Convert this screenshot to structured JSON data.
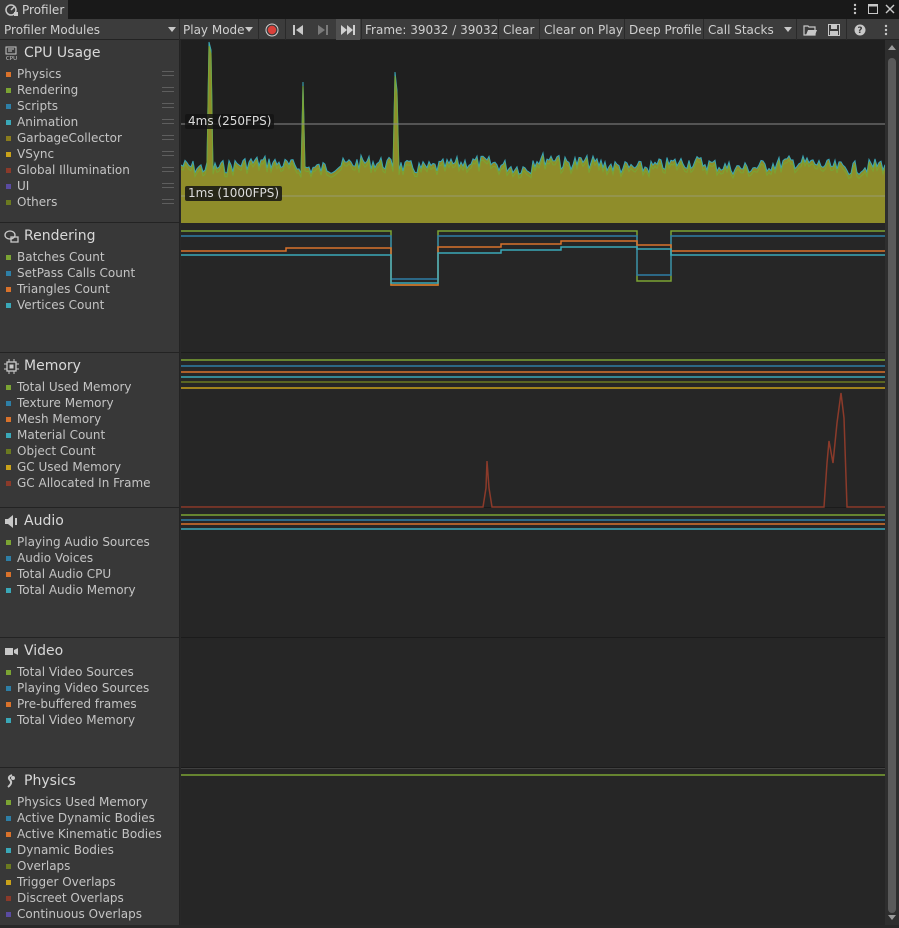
{
  "window": {
    "tab_label": "Profiler",
    "menu_icon": "kebab-menu-icon",
    "maximize_icon": "maximize-icon",
    "close_icon": "close-icon"
  },
  "toolbar": {
    "modules_dropdown": "Profiler Modules",
    "target_dropdown": "Play Mode",
    "frame_label": "Frame: 39032 / 39032",
    "clear": "Clear",
    "clear_on_play": "Clear on Play",
    "deep_profile": "Deep Profile",
    "call_stacks": "Call Stacks"
  },
  "colors": {
    "green": "#7ba433",
    "blue": "#2e7fa6",
    "orange": "#d9722b",
    "cyan": "#3aa8b8",
    "olive": "#8a7c1d",
    "yellow": "#c9a21a",
    "darkred": "#8b3a2a",
    "purple": "#5a4ba0",
    "olivegreen": "#6b7a20"
  },
  "modules": [
    {
      "id": "cpu",
      "title": "CPU Usage",
      "icon": "cpu-icon",
      "series": [
        {
          "label": "Physics",
          "color": "#d9722b"
        },
        {
          "label": "Rendering",
          "color": "#7ba433"
        },
        {
          "label": "Scripts",
          "color": "#2e7fa6"
        },
        {
          "label": "Animation",
          "color": "#3aa8b8"
        },
        {
          "label": "GarbageCollector",
          "color": "#8a7c1d"
        },
        {
          "label": "VSync",
          "color": "#c9a21a"
        },
        {
          "label": "Global Illumination",
          "color": "#8b3a2a"
        },
        {
          "label": "UI",
          "color": "#5a4ba0"
        },
        {
          "label": "Others",
          "color": "#6b7a20"
        }
      ],
      "chart_labels": [
        "4ms (250FPS)",
        "1ms (1000FPS)"
      ]
    },
    {
      "id": "rendering",
      "title": "Rendering",
      "icon": "rendering-icon",
      "series": [
        {
          "label": "Batches Count",
          "color": "#7ba433"
        },
        {
          "label": "SetPass Calls Count",
          "color": "#2e7fa6"
        },
        {
          "label": "Triangles Count",
          "color": "#d9722b"
        },
        {
          "label": "Vertices Count",
          "color": "#3aa8b8"
        }
      ]
    },
    {
      "id": "memory",
      "title": "Memory",
      "icon": "memory-chip-icon",
      "series": [
        {
          "label": "Total Used Memory",
          "color": "#7ba433"
        },
        {
          "label": "Texture Memory",
          "color": "#2e7fa6"
        },
        {
          "label": "Mesh Memory",
          "color": "#d9722b"
        },
        {
          "label": "Material Count",
          "color": "#3aa8b8"
        },
        {
          "label": "Object Count",
          "color": "#6b7a20"
        },
        {
          "label": "GC Used Memory",
          "color": "#c9a21a"
        },
        {
          "label": "GC Allocated In Frame",
          "color": "#8b3a2a"
        }
      ]
    },
    {
      "id": "audio",
      "title": "Audio",
      "icon": "speaker-icon",
      "series": [
        {
          "label": "Playing Audio Sources",
          "color": "#7ba433"
        },
        {
          "label": "Audio Voices",
          "color": "#2e7fa6"
        },
        {
          "label": "Total Audio CPU",
          "color": "#d9722b"
        },
        {
          "label": "Total Audio Memory",
          "color": "#3aa8b8"
        }
      ]
    },
    {
      "id": "video",
      "title": "Video",
      "icon": "video-camera-icon",
      "series": [
        {
          "label": "Total Video Sources",
          "color": "#7ba433"
        },
        {
          "label": "Playing Video Sources",
          "color": "#2e7fa6"
        },
        {
          "label": "Pre-buffered frames",
          "color": "#d9722b"
        },
        {
          "label": "Total Video Memory",
          "color": "#3aa8b8"
        }
      ]
    },
    {
      "id": "physics",
      "title": "Physics",
      "icon": "physics-icon",
      "series": [
        {
          "label": "Physics Used Memory",
          "color": "#7ba433"
        },
        {
          "label": "Active Dynamic Bodies",
          "color": "#2e7fa6"
        },
        {
          "label": "Active Kinematic Bodies",
          "color": "#d9722b"
        },
        {
          "label": "Dynamic Bodies",
          "color": "#3aa8b8"
        },
        {
          "label": "Overlaps",
          "color": "#6b7a20"
        },
        {
          "label": "Trigger Overlaps",
          "color": "#c9a21a"
        },
        {
          "label": "Discreet Overlaps",
          "color": "#8b3a2a"
        },
        {
          "label": "Continuous Overlaps",
          "color": "#5a4ba0"
        }
      ]
    }
  ]
}
